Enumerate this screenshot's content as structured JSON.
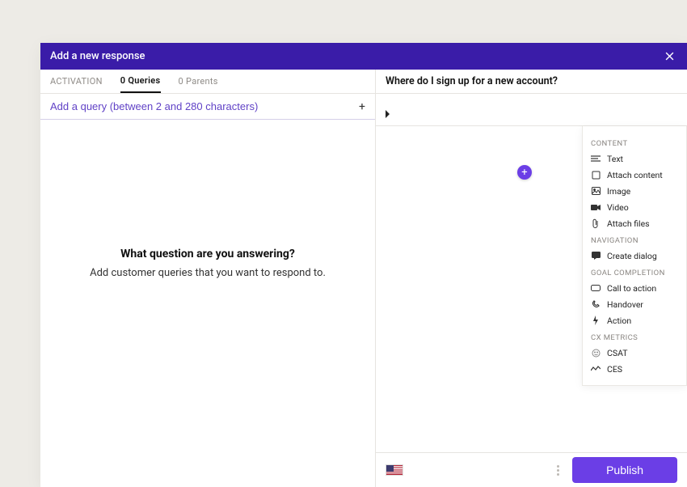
{
  "header": {
    "title": "Add a new response"
  },
  "left": {
    "tabs": {
      "activation": "ACTIVATION",
      "queries": "0 Queries",
      "parents": "0 Parents"
    },
    "query_placeholder": "Add a query (between 2 and 280 characters)",
    "empty": {
      "title": "What question are you answering?",
      "subtitle": "Add customer queries that you want to respond to."
    }
  },
  "right": {
    "question": "Where do I sign up for a new account?"
  },
  "menu": {
    "sections": {
      "content": "CONTENT",
      "navigation": "NAVIGATION",
      "goal": "GOAL COMPLETION",
      "cx": "CX METRICS"
    },
    "items": {
      "text": "Text",
      "attach_content": "Attach content",
      "image": "Image",
      "video": "Video",
      "attach_files": "Attach files",
      "create_dialog": "Create dialog",
      "call_to_action": "Call to action",
      "handover": "Handover",
      "action": "Action",
      "csat": "CSAT",
      "ces": "CES"
    }
  },
  "footer": {
    "publish": "Publish"
  }
}
